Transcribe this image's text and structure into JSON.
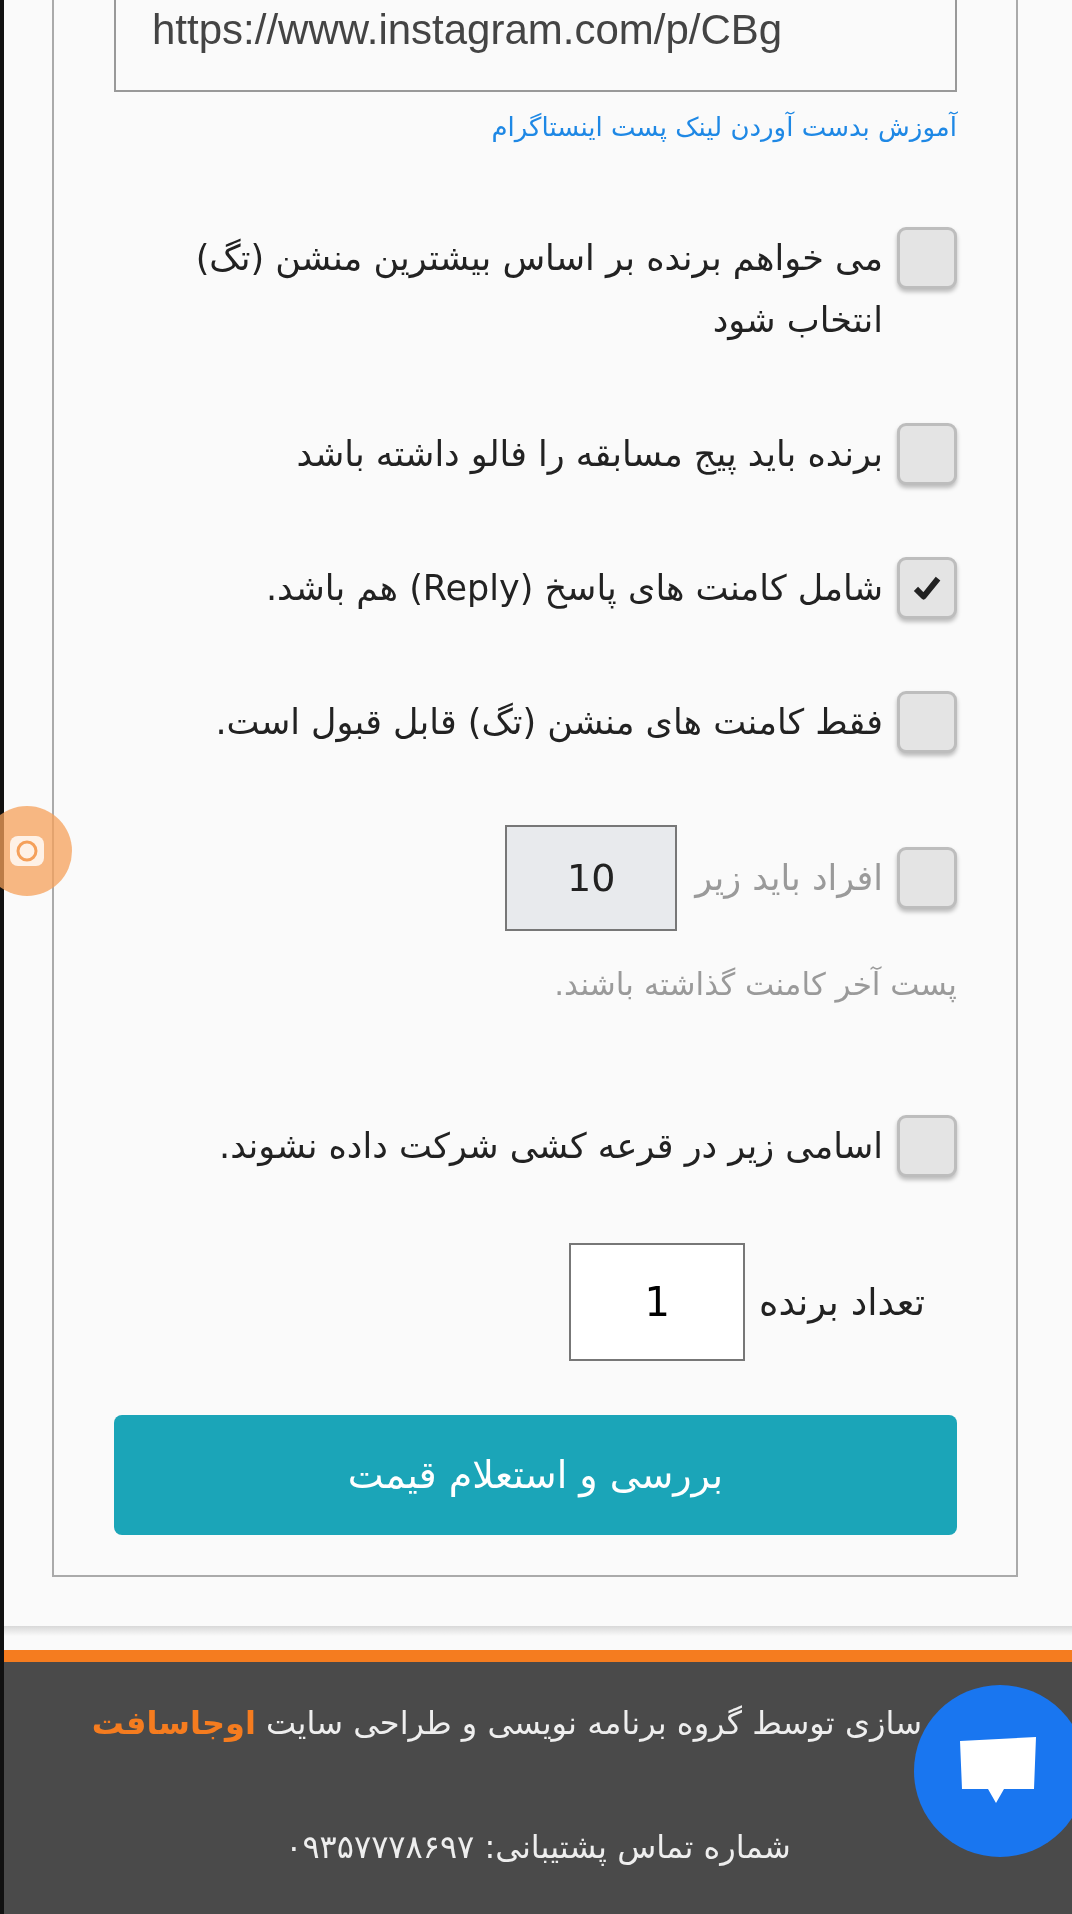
{
  "url_field": {
    "value": "https://www.instagram.com/p/CBg"
  },
  "help_link": "آموزش بدست آوردن لینک پست اینستاگرام",
  "options": [
    {
      "kind": "checkbox",
      "label": "می خواهم برنده بر اساس بیشترین منشن (تگ) انتخاب شود",
      "checked": false,
      "disabled": false
    },
    {
      "kind": "checkbox",
      "label": "برنده باید پیج مسابقه را فالو داشته باشد",
      "checked": false,
      "disabled": false
    },
    {
      "kind": "checkbox",
      "label": "شامل کامنت های پاسخ (Reply) هم باشد.",
      "checked": true,
      "disabled": false
    },
    {
      "kind": "checkbox",
      "label": "فقط کامنت های منشن (تگ) قابل قبول است.",
      "checked": false,
      "disabled": false
    },
    {
      "kind": "threshold",
      "label": "افراد باید زیر",
      "value": "10",
      "note": "پست آخر کامنت گذاشته باشند.",
      "checked": false,
      "disabled": true
    },
    {
      "kind": "checkbox",
      "label": "اسامی زیر در قرعه کشی شرکت داده نشوند.",
      "checked": false,
      "disabled": false
    }
  ],
  "winner_count": {
    "label": "تعداد برنده",
    "value": "1"
  },
  "submit_button": "بررسی و استعلام قیمت",
  "footer": {
    "credit": "سازی توسط گروه برنامه نویسی و طراحی سایت **اوجاسافت**",
    "phone": "شماره تماس پشتیبانی: ۰۹۳۵۷۷۷۸۶۹۷"
  }
}
